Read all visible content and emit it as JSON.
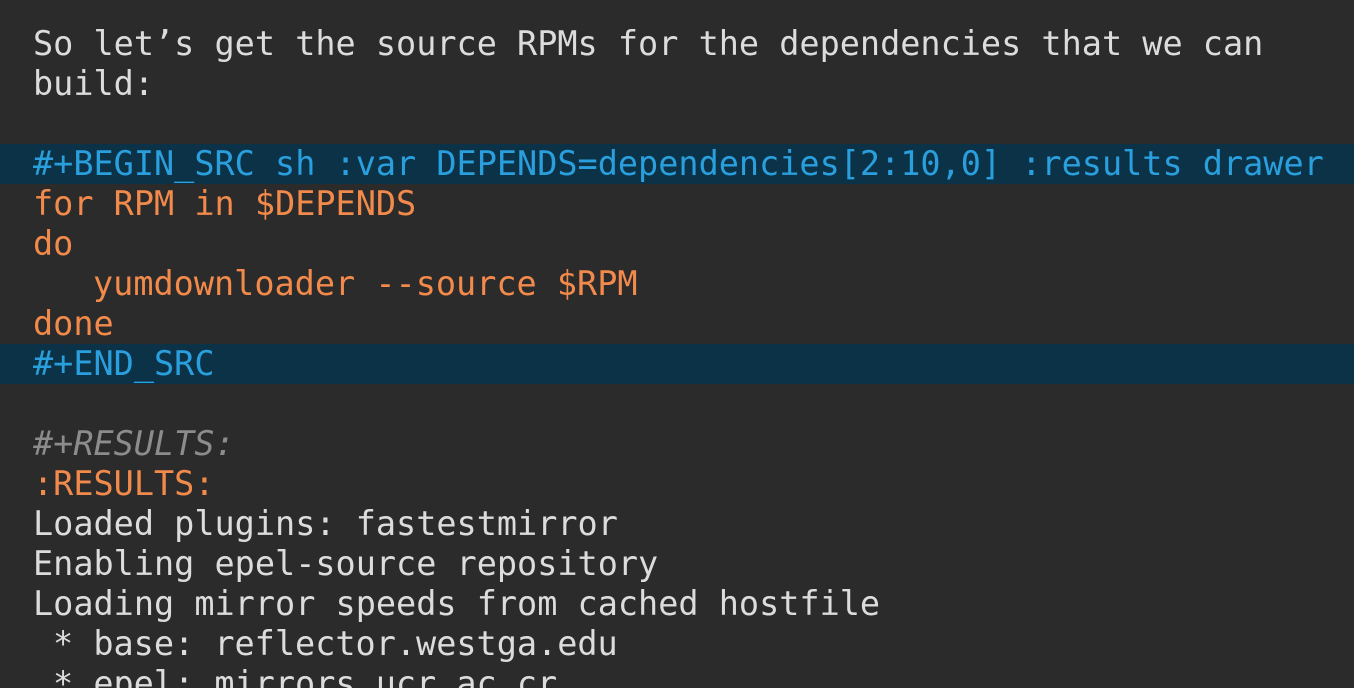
{
  "prose": {
    "line1": "So let’s get the source RPMs for the dependencies that we can",
    "line2": "build:"
  },
  "src_block": {
    "begin": "#+BEGIN_SRC sh :var DEPENDS=dependencies[2:10,0] :results drawer",
    "code": [
      "for RPM in $DEPENDS",
      "do",
      "yumdownloader --source $RPM",
      "done"
    ],
    "end": "#+END_SRC"
  },
  "results": {
    "keyword": "#+RESULTS:",
    "drawer_start": ":RESULTS:",
    "output": [
      "Loaded plugins: fastestmirror",
      "Enabling epel-source repository",
      "Loading mirror speeds from cached hostfile",
      "* base: reflector.westga.edu",
      "* epel: mirrors.ucr.ac.cr"
    ]
  },
  "colors": {
    "background": "#2b2b2b",
    "text": "#dcdcdc",
    "block_delimiter_bg": "#0c3247",
    "block_delimiter_fg": "#2a9fde",
    "code": "#f28a4b",
    "comment": "#8c8c8c"
  }
}
